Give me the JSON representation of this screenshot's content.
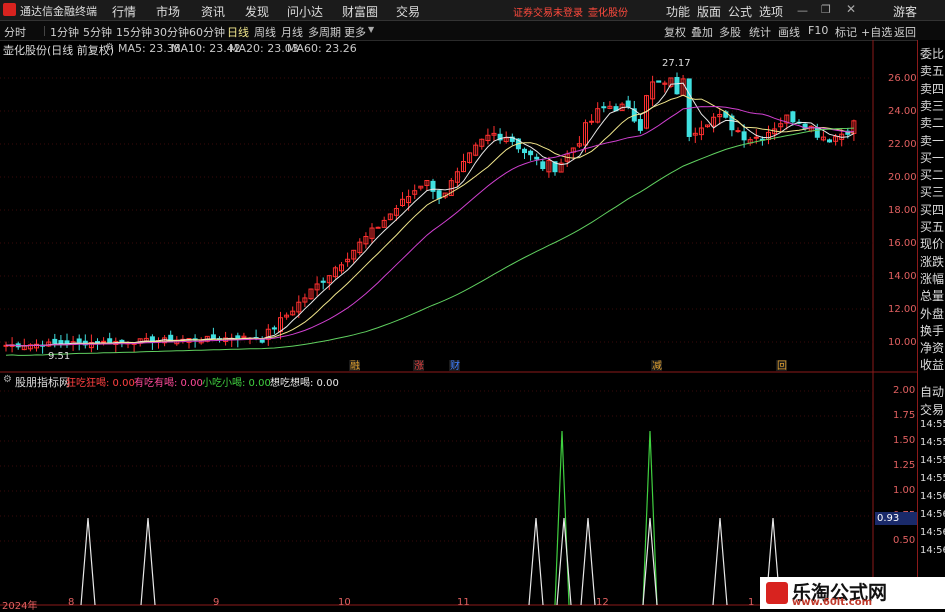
{
  "menubar": {
    "app_title": "通达信金融终端",
    "items": [
      "行情",
      "市场",
      "资讯",
      "发现",
      "问小达",
      "财富圈",
      "交易"
    ],
    "warning": "证券交易未登录",
    "stock_name": "壶化股份",
    "right_items": [
      "功能",
      "版面",
      "公式",
      "选项"
    ],
    "user": "游客"
  },
  "periodbar": {
    "periods": [
      "分时",
      "1分钟",
      "5分钟",
      "15分钟",
      "30分钟",
      "60分钟",
      "日线",
      "周线",
      "月线",
      "多周期",
      "更多"
    ],
    "active": "日线",
    "tools": [
      "复权",
      "叠加",
      "多股",
      "统计",
      "画线",
      "F10",
      "标记",
      "+自选",
      "返回"
    ]
  },
  "main_chart": {
    "stock_label": "壶化股份(日线 前复权)",
    "ma": [
      {
        "label": "MA5: 23.38",
        "color": "#e8e8e8"
      },
      {
        "label": "MA10: 23.42",
        "color": "#f0e68c"
      },
      {
        "label": "MA20: 23.03",
        "color": "#d040d0"
      },
      {
        "label": "MA60: 23.26",
        "color": "#60d060"
      }
    ],
    "high_label": "27.17",
    "low_label": "9.51",
    "y_ticks": [
      "26.00",
      "24.00",
      "22.00",
      "20.00",
      "18.00",
      "16.00",
      "14.00",
      "12.00",
      "10.00"
    ],
    "markers": [
      {
        "text": "融",
        "color": "#e0a030"
      },
      {
        "text": "涨",
        "color": "#e04040"
      },
      {
        "text": "财",
        "color": "#4080ff"
      },
      {
        "text": "减",
        "color": "#e0a030"
      },
      {
        "text": "回",
        "color": "#e0a030"
      }
    ]
  },
  "indicator": {
    "name": "股朋指标网",
    "lines": [
      {
        "label": "狂吃狂喝: 0.00",
        "color": "#ff4040"
      },
      {
        "label": "有吃有喝: 0.00",
        "color": "#ff4a9a"
      },
      {
        "label": "小吃小喝: 0.00",
        "color": "#40d040"
      },
      {
        "label": "想吃想喝: 0.00",
        "color": "#e8e8e8"
      }
    ],
    "y_ticks": [
      "2.00",
      "1.75",
      "1.50",
      "1.25",
      "1.00",
      "0.75",
      "0.50"
    ],
    "current_value": "0.93"
  },
  "xaxis": [
    "2024年",
    "8",
    "9",
    "10",
    "11",
    "12",
    "1"
  ],
  "right_panel": {
    "top_items": [
      "委比",
      "卖五",
      "卖四",
      "卖三",
      "卖二",
      "卖一",
      "买一",
      "买二",
      "买三",
      "买四",
      "买五",
      "现价",
      "涨跌",
      "涨幅",
      "总量",
      "外盘",
      "换手",
      "净资",
      "收益"
    ],
    "bottom_items": [
      "自动",
      "交易",
      "14:55",
      "14:55",
      "14:55",
      "14:55",
      "14:56",
      "14:56",
      "14:56",
      "14:56"
    ]
  },
  "watermark": {
    "title": "乐淘公式网",
    "url": "www.60lt.com"
  },
  "colors": {
    "up": "#ff3030",
    "down": "#40e0e0",
    "grid": "#8b1a1a"
  }
}
